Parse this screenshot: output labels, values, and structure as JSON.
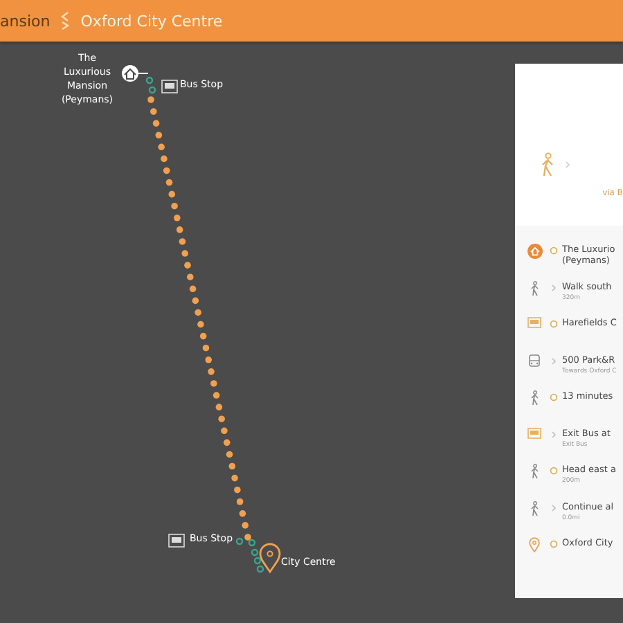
{
  "header": {
    "breadcrumb": [
      {
        "label": "ansion",
        "selected": false
      },
      {
        "label": "Oxford City Centre",
        "selected": true
      }
    ]
  },
  "map": {
    "origin_label": "The Luxurious Mansion (Peymans)",
    "start_stop_label": "Bus Stop",
    "end_stop_label": "Bus Stop",
    "destination_label": "City Centre"
  },
  "panel": {
    "via": "via B",
    "steps": [
      {
        "kind": "home",
        "title": "The Luxurio",
        "subtitle": "(Peymans)",
        "details": false
      },
      {
        "kind": "walk",
        "title": "Walk south",
        "subtitle": "320m",
        "details": true
      },
      {
        "kind": "stop",
        "title": "Harefields C",
        "details": false
      },
      {
        "kind": "bus",
        "title": "500 Park&R",
        "subtitle": "Towards Oxford C",
        "details": true
      },
      {
        "kind": "walk",
        "title": "13 minutes",
        "details": false
      },
      {
        "kind": "stop",
        "title": "Exit Bus at",
        "subtitle": "Exit Bus",
        "details": true
      },
      {
        "kind": "walk",
        "title": "Head east a",
        "subtitle": "200m",
        "details": false
      },
      {
        "kind": "walk",
        "title": "Continue al",
        "subtitle": "0.0mi",
        "details": true
      },
      {
        "kind": "pin",
        "title": "Oxford City",
        "details": false
      }
    ]
  }
}
